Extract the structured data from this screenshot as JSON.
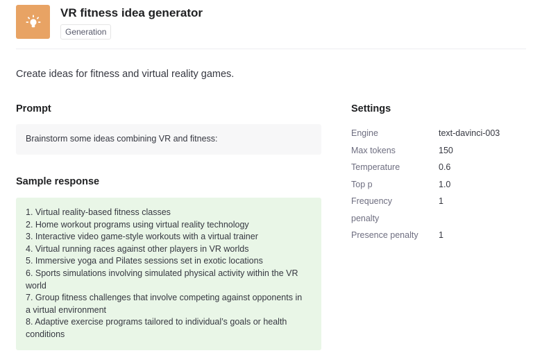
{
  "header": {
    "icon": "lightbulb-icon",
    "title": "VR fitness idea generator",
    "tag": "Generation"
  },
  "description": "Create ideas for fitness and virtual reality games.",
  "prompt": {
    "heading": "Prompt",
    "text": "Brainstorm some ideas combining VR and fitness:"
  },
  "sample_response": {
    "heading": "Sample response",
    "lines": [
      "1. Virtual reality-based fitness classes",
      "2. Home workout programs using virtual reality technology",
      "3. Interactive video game-style workouts with a virtual trainer",
      "4. Virtual running races against other players in VR worlds",
      "5. Immersive yoga and Pilates sessions set in exotic locations",
      "6. Sports simulations involving simulated physical activity within the VR",
      "world",
      "7. Group fitness challenges that involve competing against opponents in",
      "a virtual environment",
      "8. Adaptive exercise programs tailored to individual’s goals or health",
      "conditions"
    ]
  },
  "settings": {
    "heading": "Settings",
    "rows": [
      {
        "label": "Engine",
        "value": "text-davinci-003"
      },
      {
        "label": "Max tokens",
        "value": "150"
      },
      {
        "label": "Temperature",
        "value": "0.6"
      },
      {
        "label": "Top p",
        "value": "1.0"
      },
      {
        "label": "Frequency",
        "value": "1"
      },
      {
        "label": "penalty",
        "value": ""
      },
      {
        "label": "Presence penalty",
        "value": "1"
      }
    ]
  },
  "colors": {
    "icon_bg": "#e8a364",
    "prompt_bg": "#f7f7f8",
    "response_bg": "#e9f6e7"
  }
}
